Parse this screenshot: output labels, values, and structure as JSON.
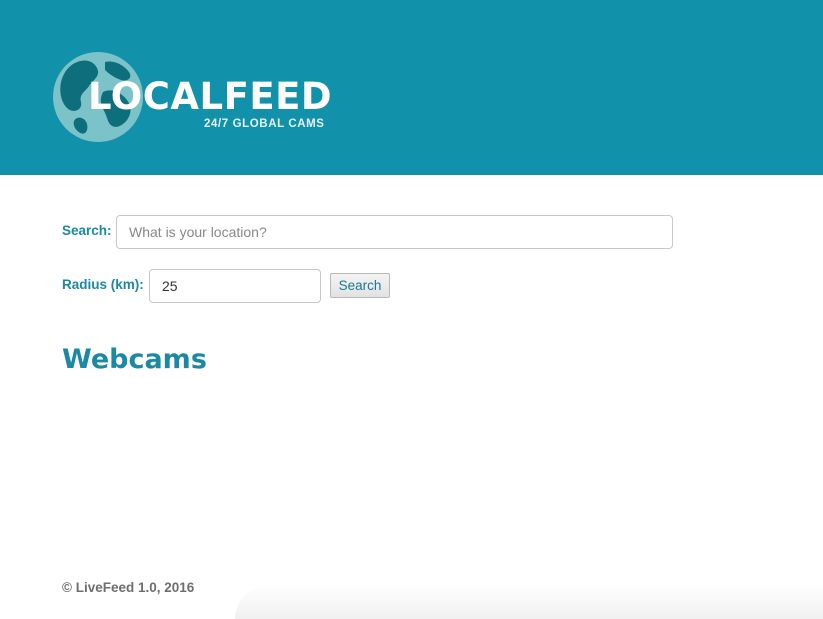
{
  "header": {
    "brand_title": "LOCALFEED",
    "brand_subtitle": "24/7 GLOBAL CAMS",
    "background_color": "#1291aa",
    "logo_icon": "globe-icon"
  },
  "search": {
    "label": "Search:",
    "placeholder": "What is your location?",
    "value": ""
  },
  "radius": {
    "label": "Radius (km):",
    "value": "25"
  },
  "search_button": {
    "label": "Search"
  },
  "main": {
    "section_title": "Webcams"
  },
  "footer": {
    "text": "© LiveFeed 1.0, 2016"
  },
  "colors": {
    "accent": "#1a8aa3",
    "footer_text": "#6e6e6e"
  }
}
